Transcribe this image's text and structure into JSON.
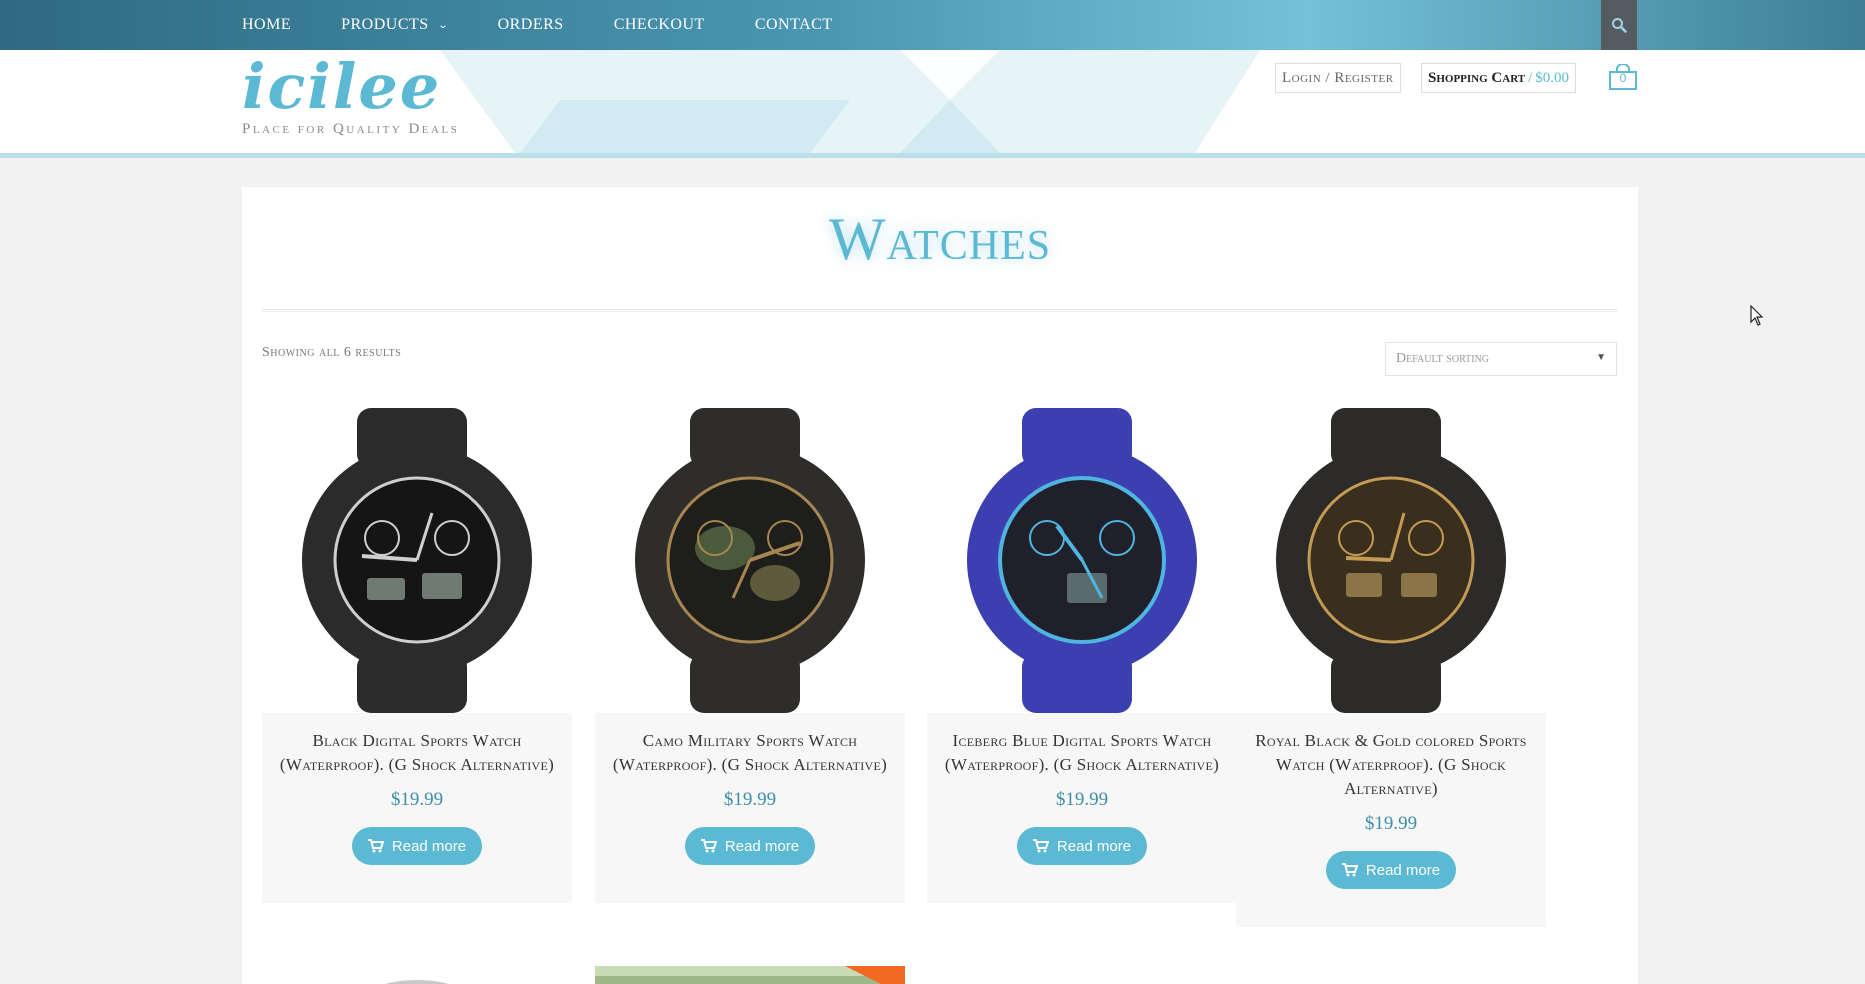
{
  "nav": {
    "items": [
      {
        "label": "Home",
        "has_dropdown": false
      },
      {
        "label": "Products",
        "has_dropdown": true
      },
      {
        "label": "Orders",
        "has_dropdown": false
      },
      {
        "label": "Checkout",
        "has_dropdown": false
      },
      {
        "label": "Contact",
        "has_dropdown": false
      }
    ],
    "search_icon": "search-icon"
  },
  "header": {
    "logo": "icilee",
    "tagline": "Place for Quality Deals",
    "login_label": "Login / Register",
    "cart_label": "Shopping Cart",
    "cart_separator": "/",
    "cart_total": "$0.00",
    "cart_count": "0"
  },
  "page": {
    "title": "Watches",
    "result_count": "Showing all 6 results",
    "sort_selected": "Default sorting"
  },
  "products": [
    {
      "name": "Black Digital Sports Watch (Waterproof). (G Shock Alternative)",
      "price": "$19.99",
      "button": "Read more",
      "watch_color": "#2b2b2b",
      "accent": "#cfcfcf"
    },
    {
      "name": "Camo Military Sports Watch (Waterproof). (G Shock Alternative)",
      "price": "$19.99",
      "button": "Read more",
      "watch_color": "#2e2d2a",
      "accent": "#a88652"
    },
    {
      "name": "Iceberg Blue Digital Sports Watch (Waterproof). (G Shock Alternative)",
      "price": "$19.99",
      "button": "Read more",
      "watch_color": "#3b3fb0",
      "accent": "#4fb4e0"
    },
    {
      "name": "Royal Black & Gold colored Sports Watch (Waterproof). (G Shock Alternative)",
      "price": "$19.99",
      "button": "Read more",
      "watch_color": "#2c2b28",
      "accent": "#c49a55"
    }
  ],
  "colors": {
    "accent": "#5bb9d3",
    "price": "#3d8ea6",
    "nav_dark": "#2e6a82"
  }
}
